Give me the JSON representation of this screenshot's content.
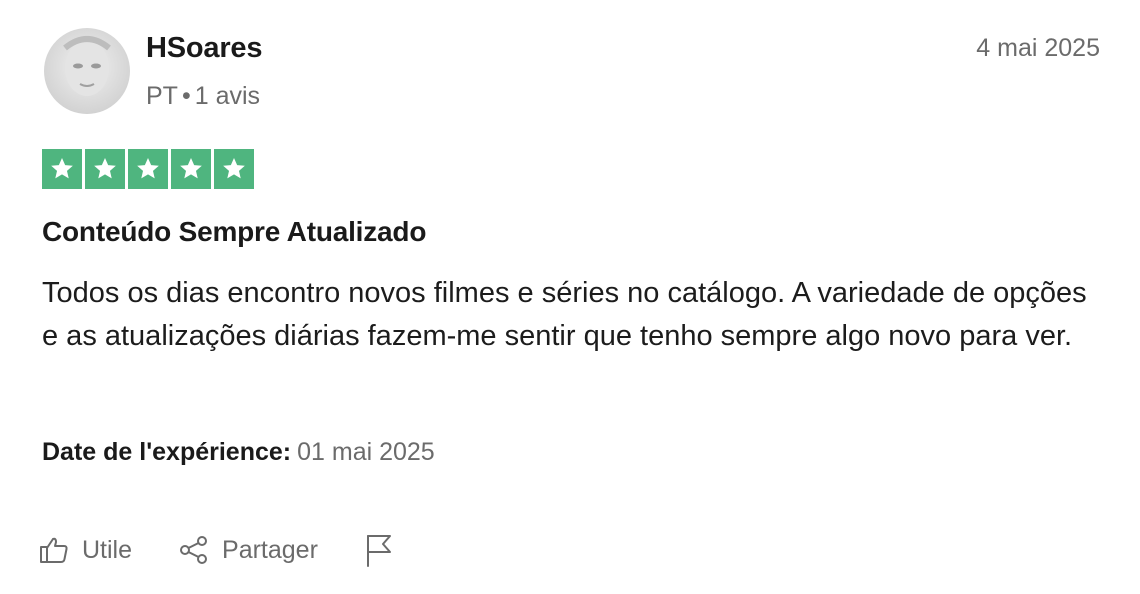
{
  "review": {
    "author": {
      "name": "HSoares",
      "country": "PT",
      "reviews_count": "1 avis"
    },
    "published_date": "4 mai 2025",
    "rating": {
      "stars": 5,
      "max": 5,
      "color": "#4fb57f"
    },
    "title": "Conteúdo Sempre Atualizado",
    "body": "Todos os dias encontro novos filmes e séries no catálogo. A variedade de opções e as atualizações diárias fazem-me sentir que tenho sempre algo novo para ver.",
    "experience": {
      "label": "Date de l'expérience:",
      "value": "01 mai 2025"
    },
    "actions": {
      "useful_label": "Utile",
      "useful_icon": "thumbs-up-icon",
      "share_label": "Partager",
      "share_icon": "share-icon",
      "report_icon": "flag-icon"
    }
  }
}
